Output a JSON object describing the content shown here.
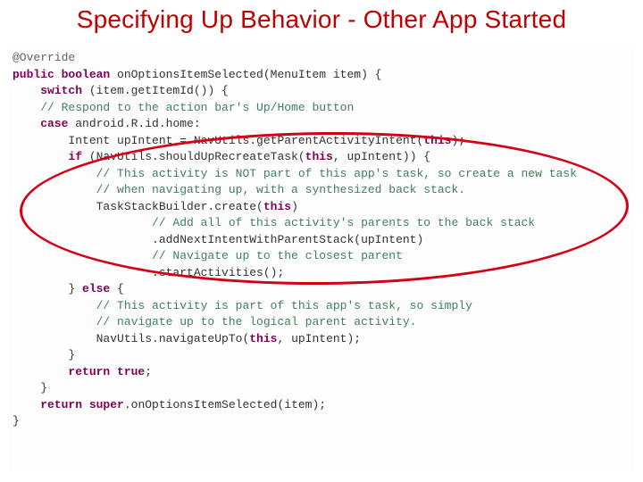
{
  "title": "Specifying Up Behavior - Other App Started",
  "code": {
    "l01": "@Override",
    "l02a": "public boolean",
    "l02b": " onOptionsItemSelected(MenuItem item) {",
    "l03a": "    switch",
    "l03b": " (item.getItemId()) {",
    "l04": "    // Respond to the action bar's Up/Home button",
    "l05a": "    case",
    "l05b": " android.R.id.home:",
    "l06a": "        Intent upIntent = NavUtils.getParentActivityIntent(",
    "l06b": "this",
    "l06c": ");",
    "l07a": "        if",
    "l07b": " (NavUtils.shouldUpRecreateTask(",
    "l07c": "this",
    "l07d": ", upIntent)) {",
    "l08": "            // This activity is NOT part of this app's task, so create a new task",
    "l09": "            // when navigating up, with a synthesized back stack.",
    "l10a": "            TaskStackBuilder.create(",
    "l10b": "this",
    "l10c": ")",
    "l11": "                    // Add all of this activity's parents to the back stack",
    "l12": "                    .addNextIntentWithParentStack(upIntent)",
    "l13": "                    // Navigate up to the closest parent",
    "l14": "                    .startActivities();",
    "l15a": "        } ",
    "l15b": "else",
    "l15c": " {",
    "l16": "            // This activity is part of this app's task, so simply",
    "l17": "            // navigate up to the logical parent activity.",
    "l18a": "            NavUtils.navigateUpTo(",
    "l18b": "this",
    "l18c": ", upIntent);",
    "l19": "        }",
    "l20a": "        return ",
    "l20b": "true",
    "l20c": ";",
    "l21": "    }",
    "l22a": "    return ",
    "l22b": "super",
    "l22c": ".onOptionsItemSelected(item);",
    "l23": "}"
  }
}
